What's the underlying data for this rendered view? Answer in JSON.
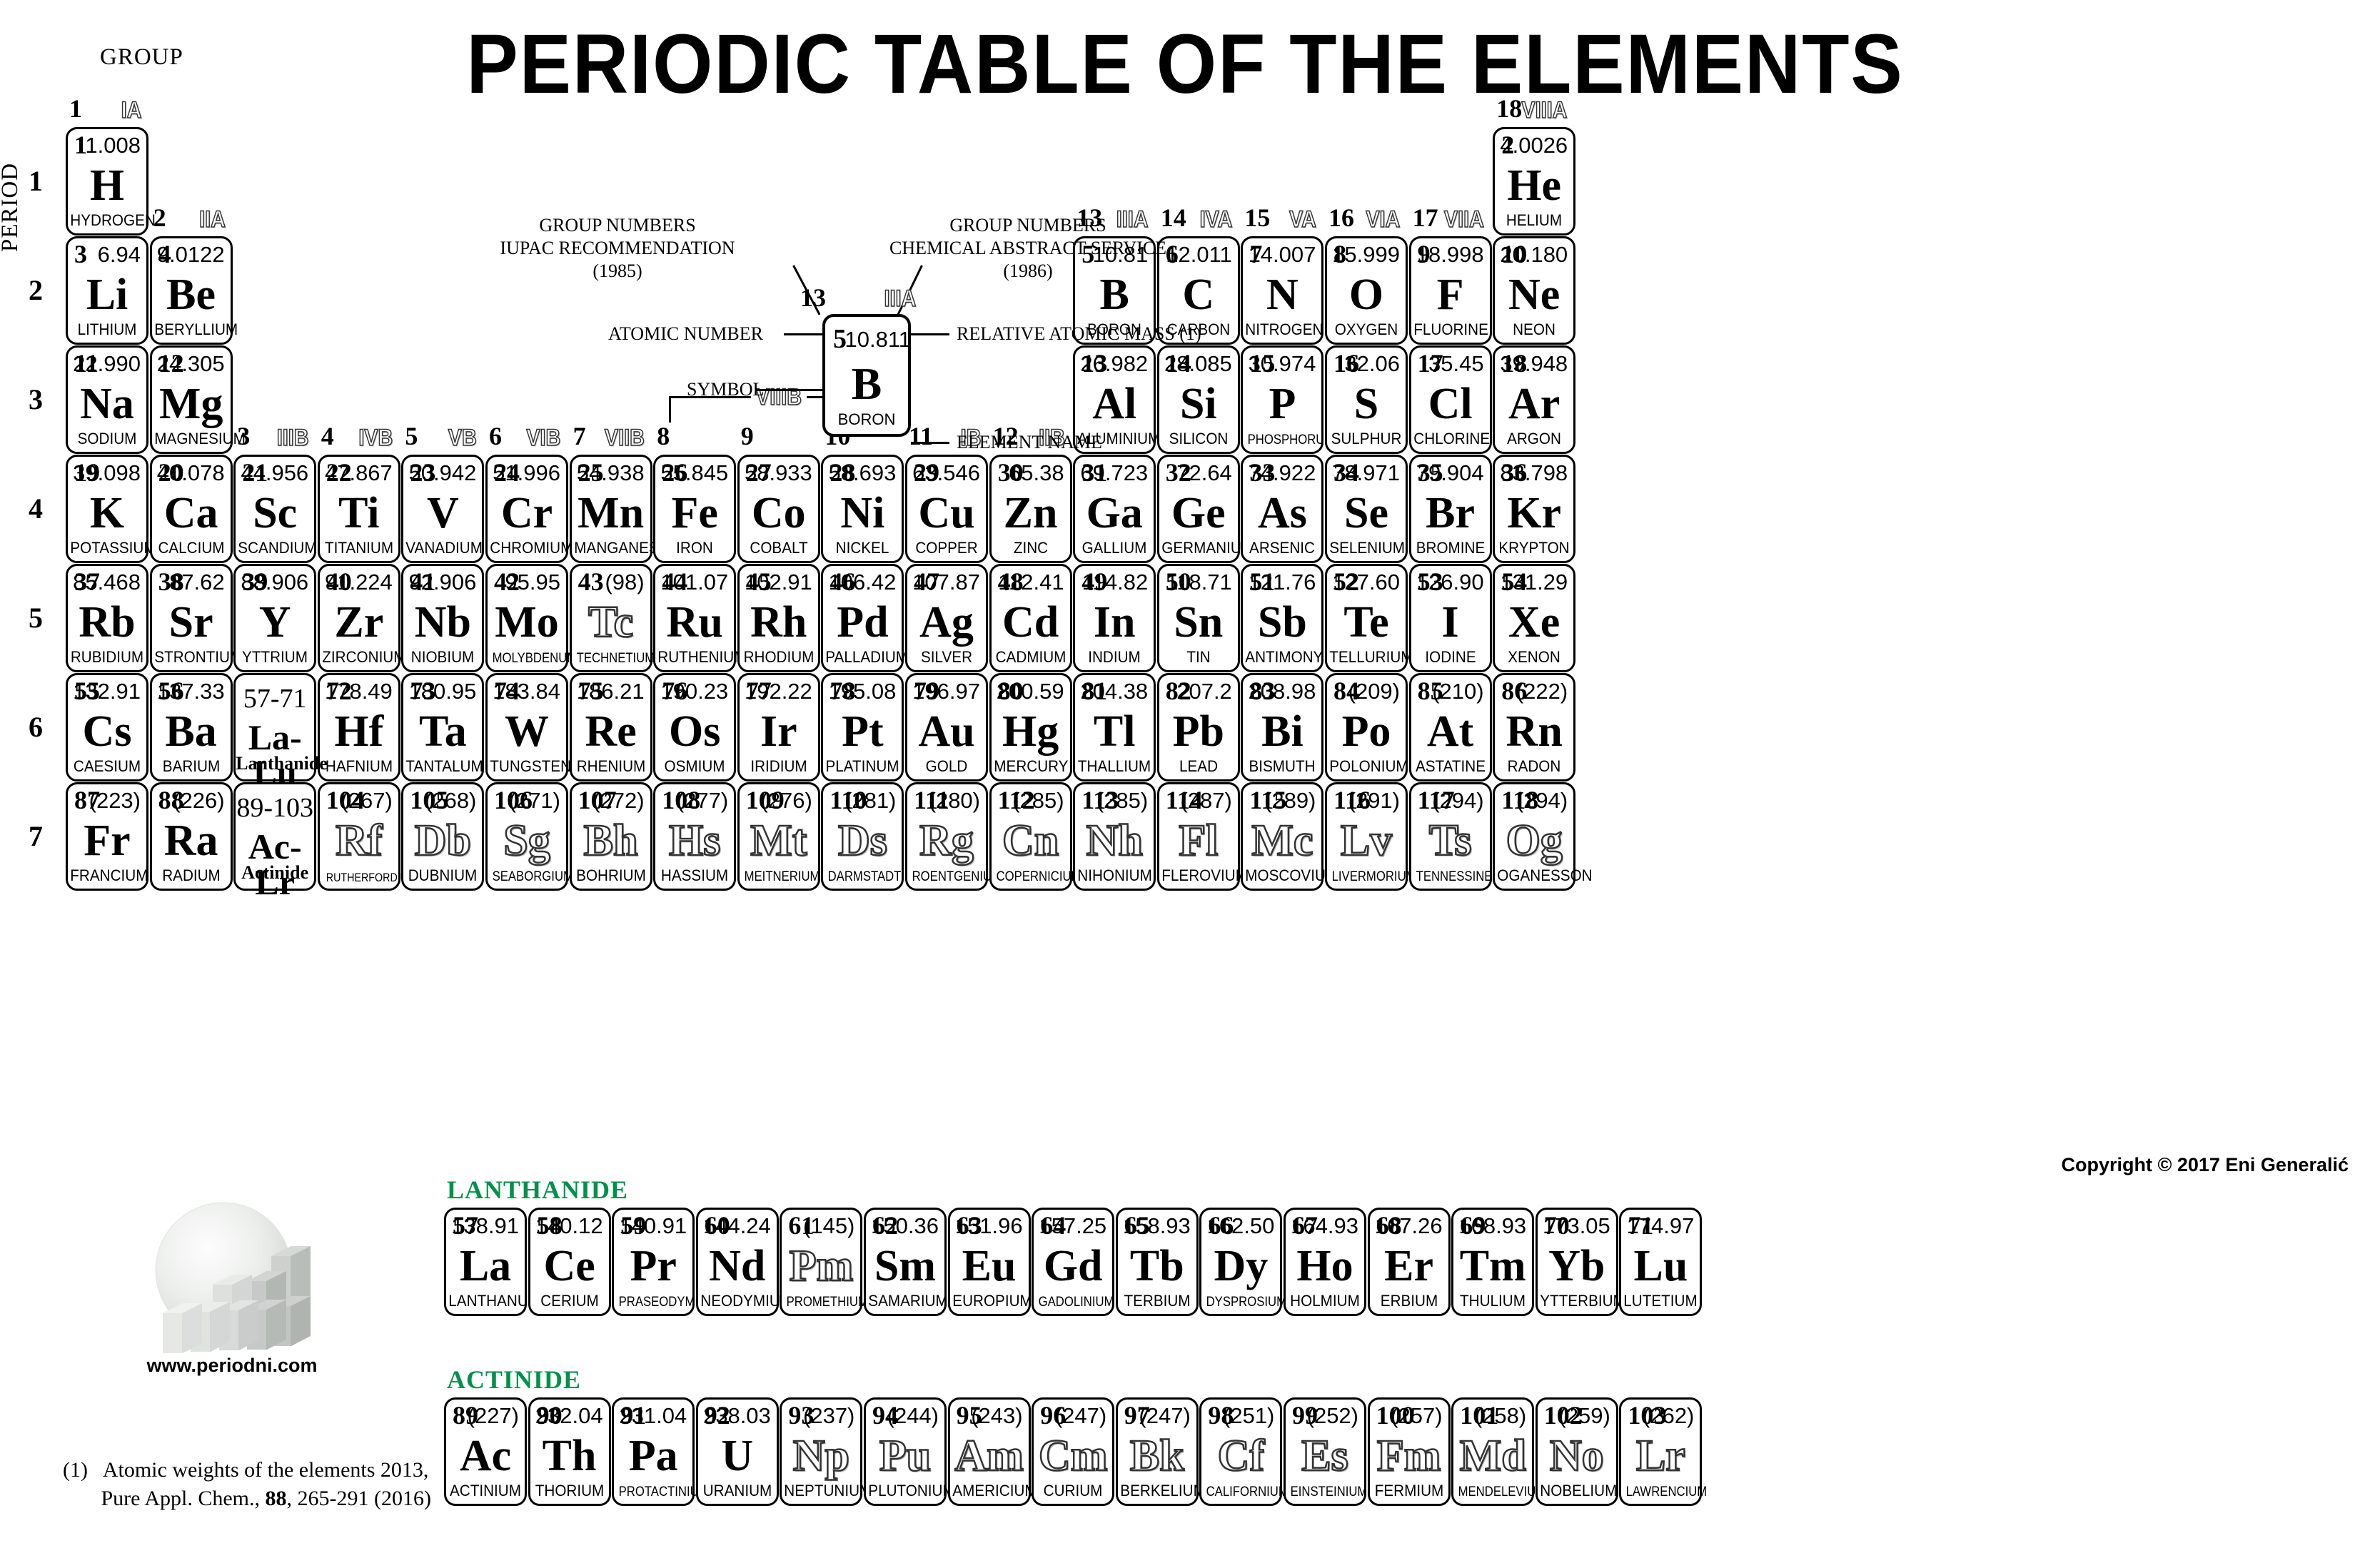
{
  "title": "PERIODIC TABLE OF THE ELEMENTS",
  "axis": {
    "group_caption": "GROUP",
    "period_caption": "PERIOD"
  },
  "copyright": "Copyright © 2017 Eni Generalić",
  "logo": {
    "url_label": "www.periodni.com"
  },
  "footnote": {
    "marker": "(1)",
    "line1": "Atomic weights of the elements 2013,",
    "line2_pre": "Pure Appl. Chem., ",
    "line2_bold": "88",
    "line2_post": ", 265-291 (2016)"
  },
  "legend": {
    "iupac_l1": "GROUP NUMBERS",
    "iupac_l2": "IUPAC RECOMMENDATION",
    "iupac_l3": "(1985)",
    "cas_l1": "GROUP NUMBERS",
    "cas_l2": "CHEMICAL ABSTRACT SERVICE",
    "cas_l3": "(1986)",
    "atomic_number_label": "ATOMIC NUMBER",
    "symbol_label": "SYMBOL",
    "relative_mass_label": "RELATIVE ATOMIC MASS (1)",
    "element_name_label": "ELEMENT NAME",
    "example": {
      "z": "5",
      "mass": "10.811",
      "symbol": "B",
      "name": "BORON",
      "group_iupac": "13",
      "group_cas": "IIIA"
    }
  },
  "series_labels": {
    "lanthanide": "LANTHANIDE",
    "actinide": "ACTINIDE"
  },
  "periods": [
    "1",
    "2",
    "3",
    "4",
    "5",
    "6",
    "7"
  ],
  "groups": [
    {
      "iupac": "1",
      "cas": "IA"
    },
    {
      "iupac": "2",
      "cas": "IIA"
    },
    {
      "iupac": "3",
      "cas": "IIIB"
    },
    {
      "iupac": "4",
      "cas": "IVB"
    },
    {
      "iupac": "5",
      "cas": "VB"
    },
    {
      "iupac": "6",
      "cas": "VIB"
    },
    {
      "iupac": "7",
      "cas": "VIIB"
    },
    {
      "iupac": "8",
      "cas": ""
    },
    {
      "iupac": "9",
      "cas": ""
    },
    {
      "iupac": "10",
      "cas": ""
    },
    {
      "iupac": "11",
      "cas": "IB"
    },
    {
      "iupac": "12",
      "cas": "IIB"
    },
    {
      "iupac": "13",
      "cas": "IIIA"
    },
    {
      "iupac": "14",
      "cas": "IVA"
    },
    {
      "iupac": "15",
      "cas": "VA"
    },
    {
      "iupac": "16",
      "cas": "VIA"
    },
    {
      "iupac": "17",
      "cas": "VIIA"
    },
    {
      "iupac": "18",
      "cas": "VIIIA"
    }
  ],
  "group_viiib_label": "VIIIB",
  "placeholders": [
    {
      "range": "57-71",
      "symbol": "La-Lu",
      "series": "Lanthanide",
      "group": 3,
      "period": 6
    },
    {
      "range": "89-103",
      "symbol": "Ac-Lr",
      "series": "Actinide",
      "group": 3,
      "period": 7
    }
  ],
  "elements": [
    {
      "z": 1,
      "m": "1.008",
      "s": "H",
      "n": "HYDROGEN",
      "g": 1,
      "p": 1,
      "h": false
    },
    {
      "z": 2,
      "m": "4.0026",
      "s": "He",
      "n": "HELIUM",
      "g": 18,
      "p": 1,
      "h": false
    },
    {
      "z": 3,
      "m": "6.94",
      "s": "Li",
      "n": "LITHIUM",
      "g": 1,
      "p": 2,
      "h": false
    },
    {
      "z": 4,
      "m": "9.0122",
      "s": "Be",
      "n": "BERYLLIUM",
      "g": 2,
      "p": 2,
      "h": false
    },
    {
      "z": 5,
      "m": "10.81",
      "s": "B",
      "n": "BORON",
      "g": 13,
      "p": 2,
      "h": false
    },
    {
      "z": 6,
      "m": "12.011",
      "s": "C",
      "n": "CARBON",
      "g": 14,
      "p": 2,
      "h": false
    },
    {
      "z": 7,
      "m": "14.007",
      "s": "N",
      "n": "NITROGEN",
      "g": 15,
      "p": 2,
      "h": false
    },
    {
      "z": 8,
      "m": "15.999",
      "s": "O",
      "n": "OXYGEN",
      "g": 16,
      "p": 2,
      "h": false
    },
    {
      "z": 9,
      "m": "18.998",
      "s": "F",
      "n": "FLUORINE",
      "g": 17,
      "p": 2,
      "h": false
    },
    {
      "z": 10,
      "m": "20.180",
      "s": "Ne",
      "n": "NEON",
      "g": 18,
      "p": 2,
      "h": false
    },
    {
      "z": 11,
      "m": "22.990",
      "s": "Na",
      "n": "SODIUM",
      "g": 1,
      "p": 3,
      "h": false
    },
    {
      "z": 12,
      "m": "24.305",
      "s": "Mg",
      "n": "MAGNESIUM",
      "g": 2,
      "p": 3,
      "h": false
    },
    {
      "z": 13,
      "m": "26.982",
      "s": "Al",
      "n": "ALUMINIUM",
      "g": 13,
      "p": 3,
      "h": false
    },
    {
      "z": 14,
      "m": "28.085",
      "s": "Si",
      "n": "SILICON",
      "g": 14,
      "p": 3,
      "h": false
    },
    {
      "z": 15,
      "m": "30.974",
      "s": "P",
      "n": "PHOSPHORUS",
      "g": 15,
      "p": 3,
      "h": false
    },
    {
      "z": 16,
      "m": "32.06",
      "s": "S",
      "n": "SULPHUR",
      "g": 16,
      "p": 3,
      "h": false
    },
    {
      "z": 17,
      "m": "35.45",
      "s": "Cl",
      "n": "CHLORINE",
      "g": 17,
      "p": 3,
      "h": false
    },
    {
      "z": 18,
      "m": "39.948",
      "s": "Ar",
      "n": "ARGON",
      "g": 18,
      "p": 3,
      "h": false
    },
    {
      "z": 19,
      "m": "39.098",
      "s": "K",
      "n": "POTASSIUM",
      "g": 1,
      "p": 4,
      "h": false
    },
    {
      "z": 20,
      "m": "40.078",
      "s": "Ca",
      "n": "CALCIUM",
      "g": 2,
      "p": 4,
      "h": false
    },
    {
      "z": 21,
      "m": "44.956",
      "s": "Sc",
      "n": "SCANDIUM",
      "g": 3,
      "p": 4,
      "h": false
    },
    {
      "z": 22,
      "m": "47.867",
      "s": "Ti",
      "n": "TITANIUM",
      "g": 4,
      "p": 4,
      "h": false
    },
    {
      "z": 23,
      "m": "50.942",
      "s": "V",
      "n": "VANADIUM",
      "g": 5,
      "p": 4,
      "h": false
    },
    {
      "z": 24,
      "m": "51.996",
      "s": "Cr",
      "n": "CHROMIUM",
      "g": 6,
      "p": 4,
      "h": false
    },
    {
      "z": 25,
      "m": "54.938",
      "s": "Mn",
      "n": "MANGANESE",
      "g": 7,
      "p": 4,
      "h": false
    },
    {
      "z": 26,
      "m": "55.845",
      "s": "Fe",
      "n": "IRON",
      "g": 8,
      "p": 4,
      "h": false
    },
    {
      "z": 27,
      "m": "58.933",
      "s": "Co",
      "n": "COBALT",
      "g": 9,
      "p": 4,
      "h": false
    },
    {
      "z": 28,
      "m": "58.693",
      "s": "Ni",
      "n": "NICKEL",
      "g": 10,
      "p": 4,
      "h": false
    },
    {
      "z": 29,
      "m": "63.546",
      "s": "Cu",
      "n": "COPPER",
      "g": 11,
      "p": 4,
      "h": false
    },
    {
      "z": 30,
      "m": "65.38",
      "s": "Zn",
      "n": "ZINC",
      "g": 12,
      "p": 4,
      "h": false
    },
    {
      "z": 31,
      "m": "69.723",
      "s": "Ga",
      "n": "GALLIUM",
      "g": 13,
      "p": 4,
      "h": false
    },
    {
      "z": 32,
      "m": "72.64",
      "s": "Ge",
      "n": "GERMANIUM",
      "g": 14,
      "p": 4,
      "h": false
    },
    {
      "z": 33,
      "m": "74.922",
      "s": "As",
      "n": "ARSENIC",
      "g": 15,
      "p": 4,
      "h": false
    },
    {
      "z": 34,
      "m": "78.971",
      "s": "Se",
      "n": "SELENIUM",
      "g": 16,
      "p": 4,
      "h": false
    },
    {
      "z": 35,
      "m": "79.904",
      "s": "Br",
      "n": "BROMINE",
      "g": 17,
      "p": 4,
      "h": false
    },
    {
      "z": 36,
      "m": "83.798",
      "s": "Kr",
      "n": "KRYPTON",
      "g": 18,
      "p": 4,
      "h": false
    },
    {
      "z": 37,
      "m": "85.468",
      "s": "Rb",
      "n": "RUBIDIUM",
      "g": 1,
      "p": 5,
      "h": false
    },
    {
      "z": 38,
      "m": "87.62",
      "s": "Sr",
      "n": "STRONTIUM",
      "g": 2,
      "p": 5,
      "h": false
    },
    {
      "z": 39,
      "m": "88.906",
      "s": "Y",
      "n": "YTTRIUM",
      "g": 3,
      "p": 5,
      "h": false
    },
    {
      "z": 40,
      "m": "91.224",
      "s": "Zr",
      "n": "ZIRCONIUM",
      "g": 4,
      "p": 5,
      "h": false
    },
    {
      "z": 41,
      "m": "92.906",
      "s": "Nb",
      "n": "NIOBIUM",
      "g": 5,
      "p": 5,
      "h": false
    },
    {
      "z": 42,
      "m": "95.95",
      "s": "Mo",
      "n": "MOLYBDENUM",
      "g": 6,
      "p": 5,
      "h": false
    },
    {
      "z": 43,
      "m": "(98)",
      "s": "Tc",
      "n": "TECHNETIUM",
      "g": 7,
      "p": 5,
      "h": true
    },
    {
      "z": 44,
      "m": "101.07",
      "s": "Ru",
      "n": "RUTHENIUM",
      "g": 8,
      "p": 5,
      "h": false
    },
    {
      "z": 45,
      "m": "102.91",
      "s": "Rh",
      "n": "RHODIUM",
      "g": 9,
      "p": 5,
      "h": false
    },
    {
      "z": 46,
      "m": "106.42",
      "s": "Pd",
      "n": "PALLADIUM",
      "g": 10,
      "p": 5,
      "h": false
    },
    {
      "z": 47,
      "m": "107.87",
      "s": "Ag",
      "n": "SILVER",
      "g": 11,
      "p": 5,
      "h": false
    },
    {
      "z": 48,
      "m": "112.41",
      "s": "Cd",
      "n": "CADMIUM",
      "g": 12,
      "p": 5,
      "h": false
    },
    {
      "z": 49,
      "m": "114.82",
      "s": "In",
      "n": "INDIUM",
      "g": 13,
      "p": 5,
      "h": false
    },
    {
      "z": 50,
      "m": "118.71",
      "s": "Sn",
      "n": "TIN",
      "g": 14,
      "p": 5,
      "h": false
    },
    {
      "z": 51,
      "m": "121.76",
      "s": "Sb",
      "n": "ANTIMONY",
      "g": 15,
      "p": 5,
      "h": false
    },
    {
      "z": 52,
      "m": "127.60",
      "s": "Te",
      "n": "TELLURIUM",
      "g": 16,
      "p": 5,
      "h": false
    },
    {
      "z": 53,
      "m": "126.90",
      "s": "I",
      "n": "IODINE",
      "g": 17,
      "p": 5,
      "h": false
    },
    {
      "z": 54,
      "m": "131.29",
      "s": "Xe",
      "n": "XENON",
      "g": 18,
      "p": 5,
      "h": false
    },
    {
      "z": 55,
      "m": "132.91",
      "s": "Cs",
      "n": "CAESIUM",
      "g": 1,
      "p": 6,
      "h": false
    },
    {
      "z": 56,
      "m": "137.33",
      "s": "Ba",
      "n": "BARIUM",
      "g": 2,
      "p": 6,
      "h": false
    },
    {
      "z": 72,
      "m": "178.49",
      "s": "Hf",
      "n": "HAFNIUM",
      "g": 4,
      "p": 6,
      "h": false
    },
    {
      "z": 73,
      "m": "180.95",
      "s": "Ta",
      "n": "TANTALUM",
      "g": 5,
      "p": 6,
      "h": false
    },
    {
      "z": 74,
      "m": "183.84",
      "s": "W",
      "n": "TUNGSTEN",
      "g": 6,
      "p": 6,
      "h": false
    },
    {
      "z": 75,
      "m": "186.21",
      "s": "Re",
      "n": "RHENIUM",
      "g": 7,
      "p": 6,
      "h": false
    },
    {
      "z": 76,
      "m": "190.23",
      "s": "Os",
      "n": "OSMIUM",
      "g": 8,
      "p": 6,
      "h": false
    },
    {
      "z": 77,
      "m": "192.22",
      "s": "Ir",
      "n": "IRIDIUM",
      "g": 9,
      "p": 6,
      "h": false
    },
    {
      "z": 78,
      "m": "195.08",
      "s": "Pt",
      "n": "PLATINUM",
      "g": 10,
      "p": 6,
      "h": false
    },
    {
      "z": 79,
      "m": "196.97",
      "s": "Au",
      "n": "GOLD",
      "g": 11,
      "p": 6,
      "h": false
    },
    {
      "z": 80,
      "m": "200.59",
      "s": "Hg",
      "n": "MERCURY",
      "g": 12,
      "p": 6,
      "h": false
    },
    {
      "z": 81,
      "m": "204.38",
      "s": "Tl",
      "n": "THALLIUM",
      "g": 13,
      "p": 6,
      "h": false
    },
    {
      "z": 82,
      "m": "207.2",
      "s": "Pb",
      "n": "LEAD",
      "g": 14,
      "p": 6,
      "h": false
    },
    {
      "z": 83,
      "m": "208.98",
      "s": "Bi",
      "n": "BISMUTH",
      "g": 15,
      "p": 6,
      "h": false
    },
    {
      "z": 84,
      "m": "(209)",
      "s": "Po",
      "n": "POLONIUM",
      "g": 16,
      "p": 6,
      "h": false
    },
    {
      "z": 85,
      "m": "(210)",
      "s": "At",
      "n": "ASTATINE",
      "g": 17,
      "p": 6,
      "h": false
    },
    {
      "z": 86,
      "m": "(222)",
      "s": "Rn",
      "n": "RADON",
      "g": 18,
      "p": 6,
      "h": false
    },
    {
      "z": 87,
      "m": "(223)",
      "s": "Fr",
      "n": "FRANCIUM",
      "g": 1,
      "p": 7,
      "h": false
    },
    {
      "z": 88,
      "m": "(226)",
      "s": "Ra",
      "n": "RADIUM",
      "g": 2,
      "p": 7,
      "h": false
    },
    {
      "z": 104,
      "m": "(267)",
      "s": "Rf",
      "n": "RUTHERFORDIUM",
      "g": 4,
      "p": 7,
      "h": true
    },
    {
      "z": 105,
      "m": "(268)",
      "s": "Db",
      "n": "DUBNIUM",
      "g": 5,
      "p": 7,
      "h": true
    },
    {
      "z": 106,
      "m": "(271)",
      "s": "Sg",
      "n": "SEABORGIUM",
      "g": 6,
      "p": 7,
      "h": true
    },
    {
      "z": 107,
      "m": "(272)",
      "s": "Bh",
      "n": "BOHRIUM",
      "g": 7,
      "p": 7,
      "h": true
    },
    {
      "z": 108,
      "m": "(277)",
      "s": "Hs",
      "n": "HASSIUM",
      "g": 8,
      "p": 7,
      "h": true
    },
    {
      "z": 109,
      "m": "(276)",
      "s": "Mt",
      "n": "MEITNERIUM",
      "g": 9,
      "p": 7,
      "h": true
    },
    {
      "z": 110,
      "m": "(281)",
      "s": "Ds",
      "n": "DARMSTADTIUM",
      "g": 10,
      "p": 7,
      "h": true
    },
    {
      "z": 111,
      "m": "(280)",
      "s": "Rg",
      "n": "ROENTGENIUM",
      "g": 11,
      "p": 7,
      "h": true
    },
    {
      "z": 112,
      "m": "(285)",
      "s": "Cn",
      "n": "COPERNICIUM",
      "g": 12,
      "p": 7,
      "h": true
    },
    {
      "z": 113,
      "m": "(285)",
      "s": "Nh",
      "n": "NIHONIUM",
      "g": 13,
      "p": 7,
      "h": true
    },
    {
      "z": 114,
      "m": "(287)",
      "s": "Fl",
      "n": "FLEROVIUM",
      "g": 14,
      "p": 7,
      "h": true
    },
    {
      "z": 115,
      "m": "(289)",
      "s": "Mc",
      "n": "MOSCOVIUM",
      "g": 15,
      "p": 7,
      "h": true
    },
    {
      "z": 116,
      "m": "(291)",
      "s": "Lv",
      "n": "LIVERMORIUM",
      "g": 16,
      "p": 7,
      "h": true
    },
    {
      "z": 117,
      "m": "(294)",
      "s": "Ts",
      "n": "TENNESSINE",
      "g": 17,
      "p": 7,
      "h": true
    },
    {
      "z": 118,
      "m": "(294)",
      "s": "Og",
      "n": "OGANESSON",
      "g": 18,
      "p": 7,
      "h": true
    }
  ],
  "lanthanides": [
    {
      "z": 57,
      "m": "138.91",
      "s": "La",
      "n": "LANTHANUM",
      "h": false
    },
    {
      "z": 58,
      "m": "140.12",
      "s": "Ce",
      "n": "CERIUM",
      "h": false
    },
    {
      "z": 59,
      "m": "140.91",
      "s": "Pr",
      "n": "PRASEODYMIUM",
      "h": false
    },
    {
      "z": 60,
      "m": "144.24",
      "s": "Nd",
      "n": "NEODYMIUM",
      "h": false
    },
    {
      "z": 61,
      "m": "(145)",
      "s": "Pm",
      "n": "PROMETHIUM",
      "h": true
    },
    {
      "z": 62,
      "m": "150.36",
      "s": "Sm",
      "n": "SAMARIUM",
      "h": false
    },
    {
      "z": 63,
      "m": "151.96",
      "s": "Eu",
      "n": "EUROPIUM",
      "h": false
    },
    {
      "z": 64,
      "m": "157.25",
      "s": "Gd",
      "n": "GADOLINIUM",
      "h": false
    },
    {
      "z": 65,
      "m": "158.93",
      "s": "Tb",
      "n": "TERBIUM",
      "h": false
    },
    {
      "z": 66,
      "m": "162.50",
      "s": "Dy",
      "n": "DYSPROSIUM",
      "h": false
    },
    {
      "z": 67,
      "m": "164.93",
      "s": "Ho",
      "n": "HOLMIUM",
      "h": false
    },
    {
      "z": 68,
      "m": "167.26",
      "s": "Er",
      "n": "ERBIUM",
      "h": false
    },
    {
      "z": 69,
      "m": "168.93",
      "s": "Tm",
      "n": "THULIUM",
      "h": false
    },
    {
      "z": 70,
      "m": "173.05",
      "s": "Yb",
      "n": "YTTERBIUM",
      "h": false
    },
    {
      "z": 71,
      "m": "174.97",
      "s": "Lu",
      "n": "LUTETIUM",
      "h": false
    }
  ],
  "actinides": [
    {
      "z": 89,
      "m": "(227)",
      "s": "Ac",
      "n": "ACTINIUM",
      "h": false
    },
    {
      "z": 90,
      "m": "232.04",
      "s": "Th",
      "n": "THORIUM",
      "h": false
    },
    {
      "z": 91,
      "m": "231.04",
      "s": "Pa",
      "n": "PROTACTINIUM",
      "h": false
    },
    {
      "z": 92,
      "m": "238.03",
      "s": "U",
      "n": "URANIUM",
      "h": false
    },
    {
      "z": 93,
      "m": "(237)",
      "s": "Np",
      "n": "NEPTUNIUM",
      "h": true
    },
    {
      "z": 94,
      "m": "(244)",
      "s": "Pu",
      "n": "PLUTONIUM",
      "h": true
    },
    {
      "z": 95,
      "m": "(243)",
      "s": "Am",
      "n": "AMERICIUM",
      "h": true
    },
    {
      "z": 96,
      "m": "(247)",
      "s": "Cm",
      "n": "CURIUM",
      "h": true
    },
    {
      "z": 97,
      "m": "(247)",
      "s": "Bk",
      "n": "BERKELIUM",
      "h": true
    },
    {
      "z": 98,
      "m": "(251)",
      "s": "Cf",
      "n": "CALIFORNIUM",
      "h": true
    },
    {
      "z": 99,
      "m": "(252)",
      "s": "Es",
      "n": "EINSTEINIUM",
      "h": true
    },
    {
      "z": 100,
      "m": "(257)",
      "s": "Fm",
      "n": "FERMIUM",
      "h": true
    },
    {
      "z": 101,
      "m": "(258)",
      "s": "Md",
      "n": "MENDELEVIUM",
      "h": true
    },
    {
      "z": 102,
      "m": "(259)",
      "s": "No",
      "n": "NOBELIUM",
      "h": true
    },
    {
      "z": 103,
      "m": "(262)",
      "s": "Lr",
      "n": "LAWRENCIUM",
      "h": true
    }
  ],
  "colors": {
    "series_green": "#00914a",
    "ink": "#000000",
    "paper": "#ffffff"
  }
}
